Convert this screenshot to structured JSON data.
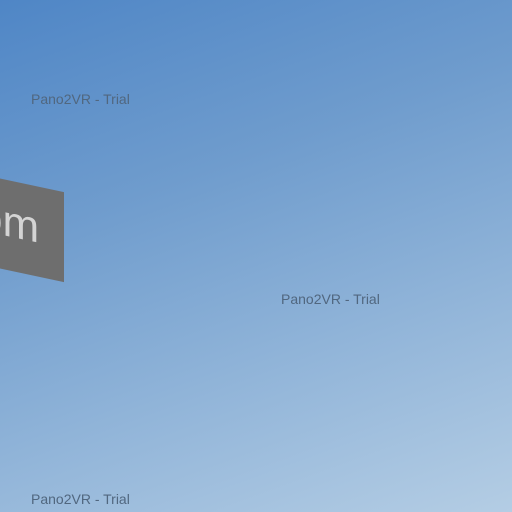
{
  "viewer": {
    "sign_text": "om",
    "watermarks": [
      "Pano2VR - Trial",
      "Pano2VR - Trial",
      "Pano2VR - Trial"
    ]
  },
  "colors": {
    "sky_top": "#4f86c6",
    "sky_bottom": "#b4cde4",
    "sign_background": "#6e6e6e",
    "sign_text": "#d4d4d4",
    "watermark_text": "#51677f"
  }
}
